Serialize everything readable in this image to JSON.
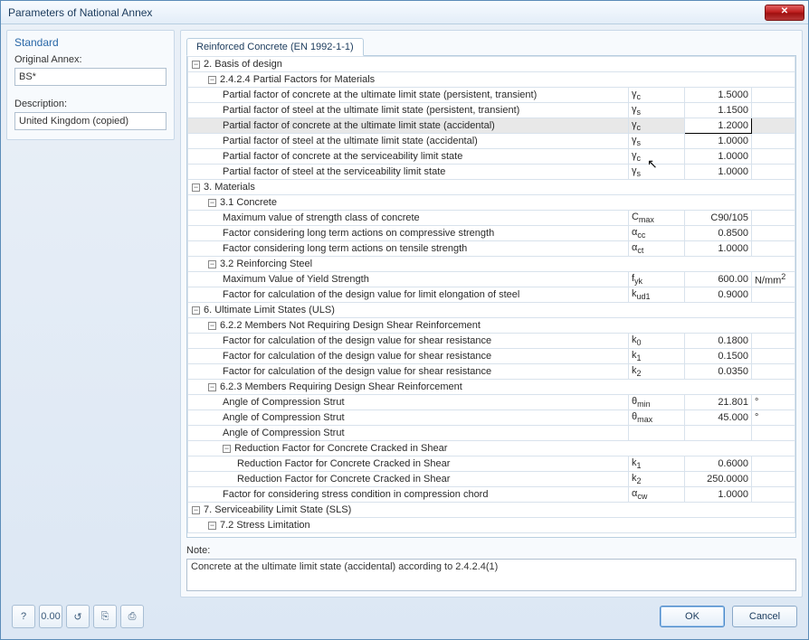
{
  "window": {
    "title": "Parameters of National Annex"
  },
  "left": {
    "group_title": "Standard",
    "original_label": "Original Annex:",
    "original_value": "BS*",
    "description_label": "Description:",
    "description_value": "United Kingdom (copied)"
  },
  "tab": {
    "label": "Reinforced Concrete (EN 1992-1-1)"
  },
  "tree": [
    {
      "type": "section",
      "indent": 0,
      "label": "2. Basis of design"
    },
    {
      "type": "section",
      "indent": 1,
      "label": "2.4.2.4 Partial Factors for Materials"
    },
    {
      "type": "row",
      "indent": 2,
      "label": "Partial factor of concrete at the ultimate limit state (persistent, transient)",
      "sym_html": "γ<sub>c</sub>",
      "val": "1.5000"
    },
    {
      "type": "row",
      "indent": 2,
      "label": "Partial factor of steel at the ultimate limit state (persistent, transient)",
      "sym_html": "γ<sub>s</sub>",
      "val": "1.1500"
    },
    {
      "type": "row",
      "indent": 2,
      "label": "Partial factor of concrete at the ultimate limit state (accidental)",
      "sym_html": "γ<sub>c</sub>",
      "val": "1.2000",
      "selected": true
    },
    {
      "type": "row",
      "indent": 2,
      "label": "Partial factor of steel at the ultimate limit state (accidental)",
      "sym_html": "γ<sub>s</sub>",
      "val": "1.0000"
    },
    {
      "type": "row",
      "indent": 2,
      "label": "Partial factor of concrete at the serviceability limit state",
      "sym_html": "γ<sub>c</sub>",
      "val": "1.0000"
    },
    {
      "type": "row",
      "indent": 2,
      "label": "Partial factor of steel at the serviceability limit state",
      "sym_html": "γ<sub>s</sub>",
      "val": "1.0000"
    },
    {
      "type": "section",
      "indent": 0,
      "label": "3. Materials"
    },
    {
      "type": "section",
      "indent": 1,
      "label": "3.1 Concrete"
    },
    {
      "type": "row",
      "indent": 2,
      "label": "Maximum value of strength class of concrete",
      "sym_html": "C<sub>max</sub>",
      "val": "C90/105"
    },
    {
      "type": "row",
      "indent": 2,
      "label": "Factor considering long term actions on compressive strength",
      "sym_html": "α<sub>cc</sub>",
      "val": "0.8500"
    },
    {
      "type": "row",
      "indent": 2,
      "label": "Factor considering long term actions on tensile strength",
      "sym_html": "α<sub>ct</sub>",
      "val": "1.0000"
    },
    {
      "type": "section",
      "indent": 1,
      "label": "3.2 Reinforcing Steel"
    },
    {
      "type": "row",
      "indent": 2,
      "label": "Maximum Value of Yield Strength",
      "sym_html": "f<sub>yk</sub>",
      "val": "600.00",
      "unit_html": "N/mm<sup>2</sup>"
    },
    {
      "type": "row",
      "indent": 2,
      "label": "Factor for calculation of the design value for limit elongation of steel",
      "sym_html": "k<sub>ud1</sub>",
      "val": "0.9000"
    },
    {
      "type": "section",
      "indent": 0,
      "label": "6. Ultimate Limit States (ULS)"
    },
    {
      "type": "section",
      "indent": 1,
      "label": "6.2.2 Members Not Requiring Design Shear Reinforcement"
    },
    {
      "type": "row",
      "indent": 2,
      "label": "Factor for calculation of the design value for shear resistance",
      "sym_html": "k<sub>0</sub>",
      "val": "0.1800"
    },
    {
      "type": "row",
      "indent": 2,
      "label": "Factor for calculation of the design value for shear resistance",
      "sym_html": "k<sub>1</sub>",
      "val": "0.1500"
    },
    {
      "type": "row",
      "indent": 2,
      "label": "Factor for calculation of the design value for shear resistance",
      "sym_html": "k<sub>2</sub>",
      "val": "0.0350"
    },
    {
      "type": "section",
      "indent": 1,
      "label": "6.2.3 Members Requiring Design Shear Reinforcement"
    },
    {
      "type": "row",
      "indent": 2,
      "label": "Angle of Compression Strut",
      "sym_html": "θ<sub>min</sub>",
      "val": "21.801",
      "unit_html": "°"
    },
    {
      "type": "row",
      "indent": 2,
      "label": "Angle of Compression Strut",
      "sym_html": "θ<sub>max</sub>",
      "val": "45.000",
      "unit_html": "°"
    },
    {
      "type": "row",
      "indent": 2,
      "label": "Angle of Compression Strut",
      "sym_html": "",
      "val": ""
    },
    {
      "type": "section",
      "indent": 2,
      "label": "Reduction Factor for Concrete Cracked in Shear"
    },
    {
      "type": "row",
      "indent": 3,
      "label": "Reduction Factor for Concrete Cracked in Shear",
      "sym_html": "k<sub>1</sub>",
      "val": "0.6000"
    },
    {
      "type": "row",
      "indent": 3,
      "label": "Reduction Factor for Concrete Cracked in Shear",
      "sym_html": "k<sub>2</sub>",
      "val": "250.0000"
    },
    {
      "type": "row",
      "indent": 2,
      "label": "Factor for considering stress condition in compression chord",
      "sym_html": "α<sub>cw</sub>",
      "val": "1.0000"
    },
    {
      "type": "section",
      "indent": 0,
      "label": "7. Serviceability Limit State (SLS)"
    },
    {
      "type": "section",
      "indent": 1,
      "label": "7.2 Stress Limitation"
    }
  ],
  "note": {
    "label": "Note:",
    "text": "Concrete at the ultimate limit state (accidental) according to 2.4.2.4(1)"
  },
  "buttons": {
    "ok": "OK",
    "cancel": "Cancel"
  },
  "toolbar": {
    "b1": "?",
    "b2": "0.00",
    "b3": "↺",
    "b4": "⎘",
    "b5": "⎙"
  }
}
